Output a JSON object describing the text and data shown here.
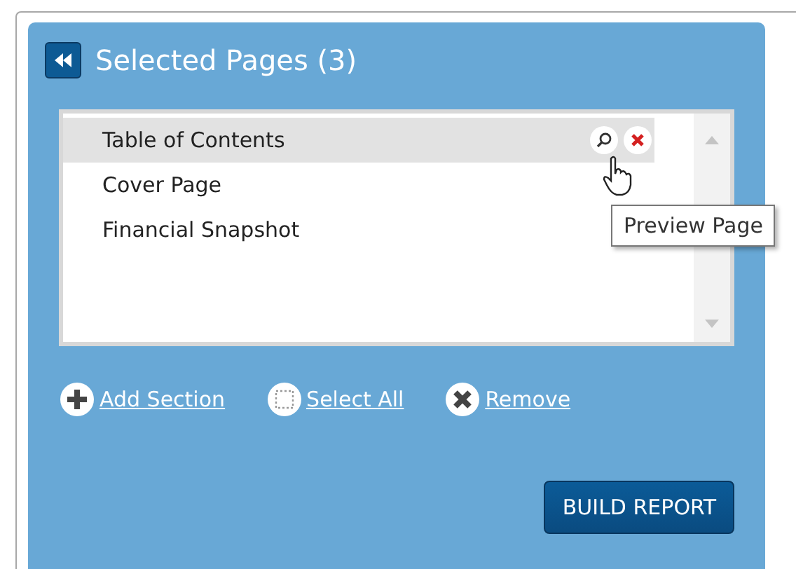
{
  "panel": {
    "title": "Selected Pages (3)"
  },
  "pages": [
    {
      "label": "Table of Contents",
      "selected": true
    },
    {
      "label": "Cover Page",
      "selected": false
    },
    {
      "label": "Financial Snapshot",
      "selected": false
    }
  ],
  "tooltip": {
    "text": "Preview Page"
  },
  "actions": [
    {
      "kind": "add",
      "label": "Add Section"
    },
    {
      "kind": "select",
      "label": "Select All"
    },
    {
      "kind": "remove",
      "label": "Remove"
    }
  ],
  "build_button": {
    "label": "BUILD REPORT"
  }
}
